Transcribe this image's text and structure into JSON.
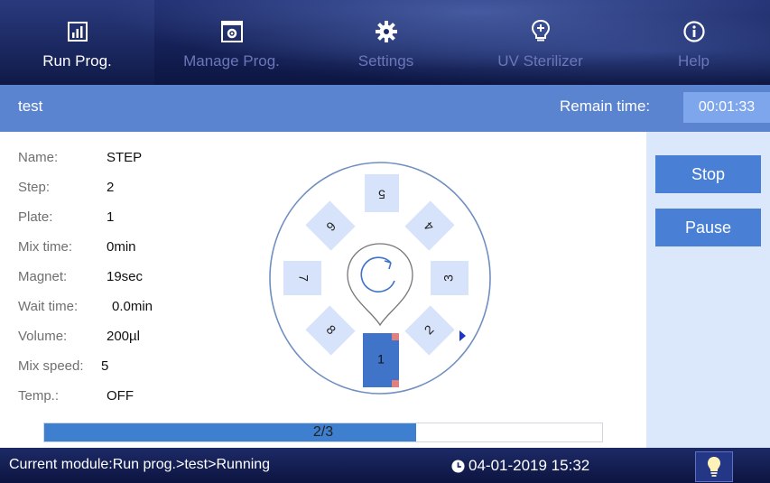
{
  "nav": {
    "tabs": [
      {
        "label": "Run Prog.",
        "icon": "chart-icon",
        "active": true
      },
      {
        "label": "Manage Prog.",
        "icon": "settings-box-icon",
        "active": false
      },
      {
        "label": "Settings",
        "icon": "gear-icon",
        "active": false
      },
      {
        "label": "UV Sterilizer",
        "icon": "uv-bulb-icon",
        "active": false
      },
      {
        "label": "Help",
        "icon": "info-icon",
        "active": false
      }
    ]
  },
  "title_bar": {
    "program_name": "test",
    "remain_label": "Remain time:",
    "remain_value": "00:01:33"
  },
  "step_info": [
    {
      "label": "Name:",
      "value": "STEP"
    },
    {
      "label": "Step:",
      "value": "2"
    },
    {
      "label": "Plate:",
      "value": "1"
    },
    {
      "label": "Mix time:",
      "value": "0min"
    },
    {
      "label": "Magnet:",
      "value": "19sec"
    },
    {
      "label": "Wait time:",
      "value": "0.0min"
    },
    {
      "label": "Volume:",
      "value": "200µl"
    },
    {
      "label": "Mix speed:",
      "value": "5"
    },
    {
      "label": "Temp.:",
      "value": "OFF"
    }
  ],
  "plate_wheel": {
    "positions": [
      "1",
      "2",
      "3",
      "4",
      "5",
      "6",
      "7",
      "8"
    ],
    "current_position": "1"
  },
  "progress": {
    "text": "2/3",
    "fraction": 0.667
  },
  "side_buttons": {
    "stop_label": "Stop",
    "pause_label": "Pause"
  },
  "status_bar": {
    "module_text": "Current module:Run prog.>test>Running",
    "datetime": "04-01-2019 15:32"
  },
  "colors": {
    "nav_bg": "#16225a",
    "title_bar_bg": "#5b84d0",
    "button_bg": "#4a7fd6",
    "side_panel_bg": "#dbe7fb",
    "progress_fill": "#3f7fd0",
    "slot_bg": "#d6e3fa",
    "active_slot_bg": "#3f74c8",
    "slot_marker": "#e08080"
  }
}
